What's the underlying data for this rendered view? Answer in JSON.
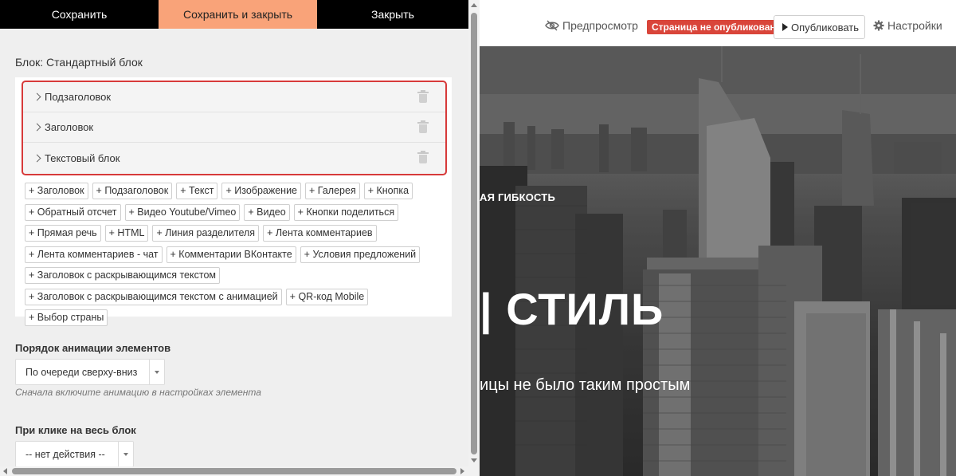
{
  "editor": {
    "toolbar": {
      "save": "Сохранить",
      "save_close": "Сохранить и закрыть",
      "close": "Закрыть"
    },
    "block_title": "Блок: Стандартный блок",
    "elements": [
      {
        "label": "Подзаголовок"
      },
      {
        "label": "Заголовок"
      },
      {
        "label": "Текстовый блок"
      }
    ],
    "add_buttons": [
      "+ Заголовок",
      "+ Подзаголовок",
      "+ Текст",
      "+ Изображение",
      "+ Галерея",
      "+ Кнопка",
      "+ Обратный отсчет",
      "+ Видео Youtube/Vimeo",
      "+ Видео",
      "+ Кнопки поделиться",
      "+ Прямая речь",
      "+ HTML",
      "+ Линия разделителя",
      "+ Лента комментариев",
      "+ Лента комментариев - чат",
      "+ Комментарии ВКонтакте",
      "+ Условия предложений",
      "+ Заголовок с раскрывающимся текстом",
      "+ Заголовок с раскрывающимся текстом с анимацией",
      "+ QR-код Mobile",
      "+ Выбор страны"
    ],
    "animation_order": {
      "label": "Порядок анимации элементов",
      "value": "По очереди сверху-вниз",
      "hint": "Сначала включите анимацию в настройках элемента"
    },
    "on_click": {
      "label": "При клике на весь блок",
      "value": "-- нет действия --"
    }
  },
  "preview": {
    "toolbar": {
      "preview": "Предпросмотр",
      "status_badge": "Страница не опубликована",
      "publish": "Опубликовать",
      "settings": "Настройки"
    },
    "hero": {
      "subtitle": "АЯ ГИБКОСТЬ",
      "title": "| СТИЛЬ",
      "description": "ицы не было таким простым"
    }
  },
  "colors": {
    "accent_orange": "#f9a379",
    "highlight_red": "#d73a3a",
    "badge_red": "#d9453a"
  }
}
